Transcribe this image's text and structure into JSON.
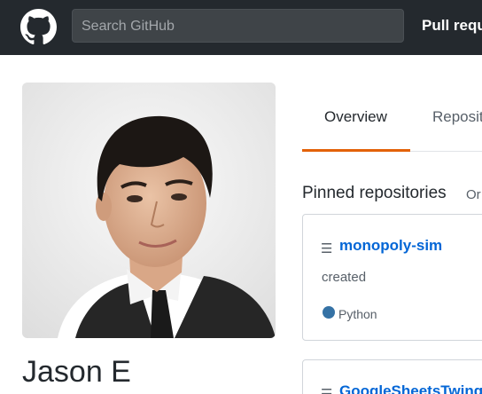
{
  "header": {
    "search_placeholder": "Search GitHub",
    "nav_link": "Pull requ"
  },
  "profile": {
    "name": "Jason E"
  },
  "tabs": [
    {
      "label": "Overview",
      "active": true
    },
    {
      "label": "Reposit",
      "active": false
    }
  ],
  "pinned": {
    "title": "Pinned repositories",
    "extra": "Or",
    "repos": [
      {
        "name": "monopoly-sim",
        "description": "created",
        "language": "Python",
        "language_color": "#3572A5"
      },
      {
        "name": "GoogleSheetsTwing"
      }
    ]
  },
  "colors": {
    "header_bg": "#24292e",
    "link": "#0366d6",
    "tab_underline": "#e36209"
  },
  "icons": {
    "logo": "github-octocat-icon",
    "repo": "repo-icon"
  }
}
